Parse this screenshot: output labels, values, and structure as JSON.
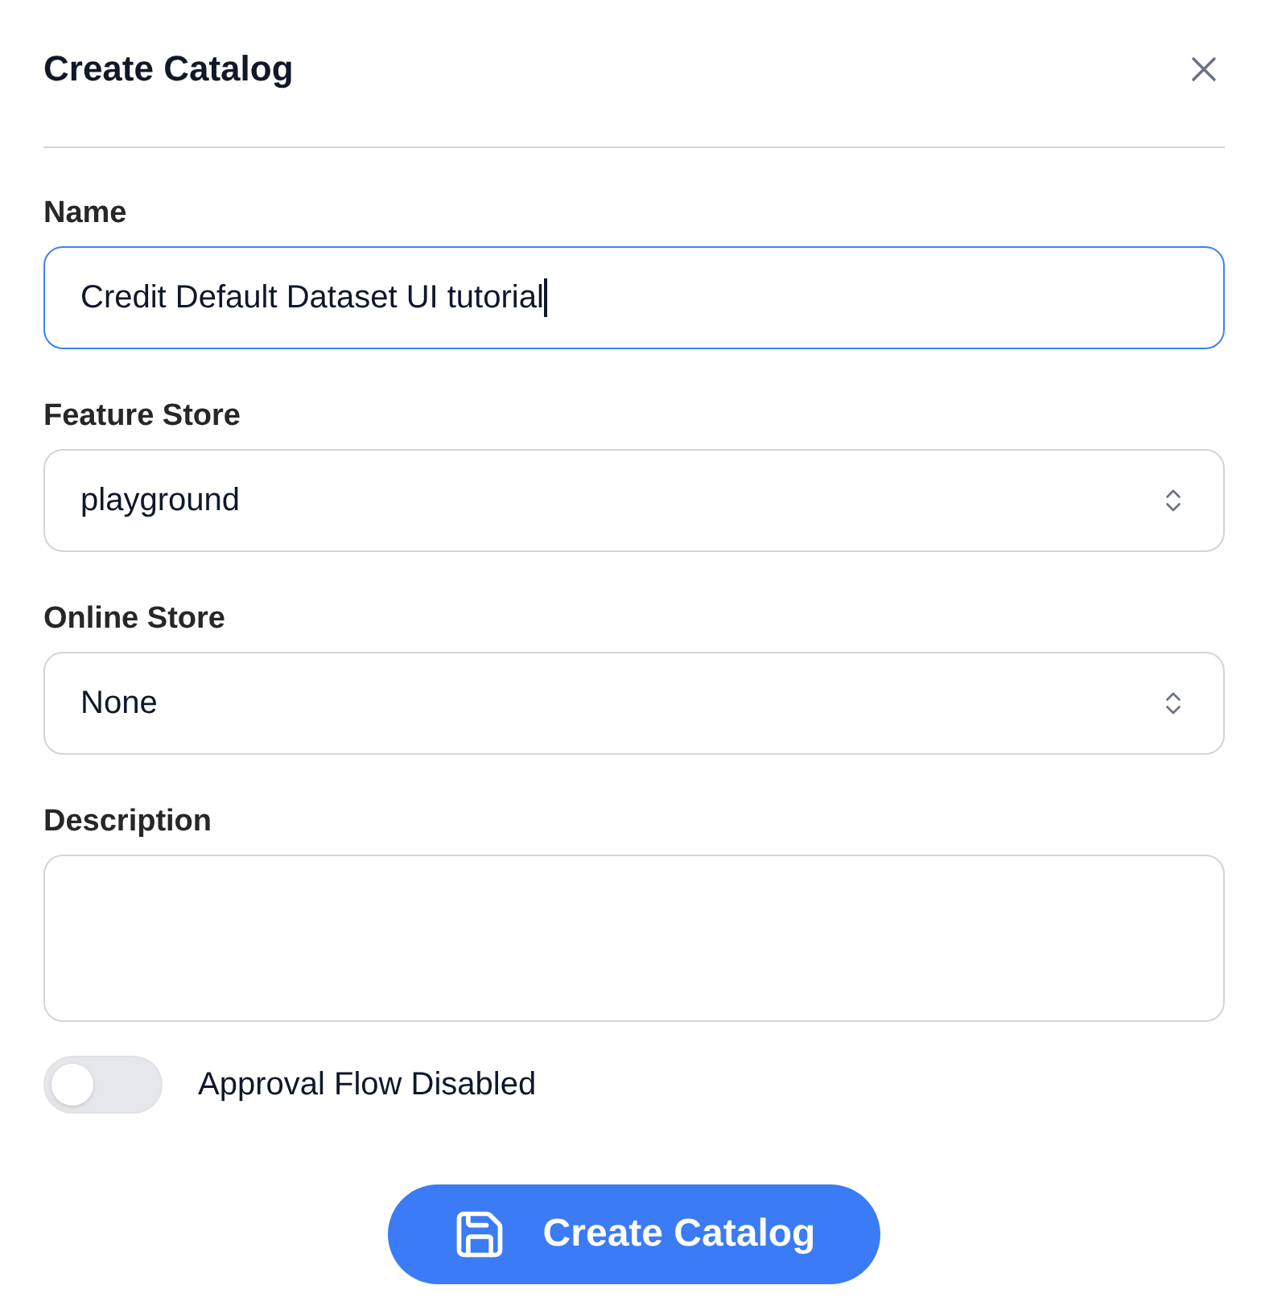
{
  "dialog": {
    "title": "Create Catalog"
  },
  "fields": [
    {
      "kind": "text",
      "label": "Name",
      "value": "Credit Default Dataset UI tutorial",
      "focused": true
    },
    {
      "kind": "select",
      "label": "Feature Store",
      "value": "playground"
    },
    {
      "kind": "select",
      "label": "Online Store",
      "value": "None"
    },
    {
      "kind": "textarea",
      "label": "Description"
    }
  ],
  "toggle": {
    "label": "Approval Flow Disabled",
    "on": false
  },
  "submit_button": {
    "label": "Create Catalog"
  }
}
